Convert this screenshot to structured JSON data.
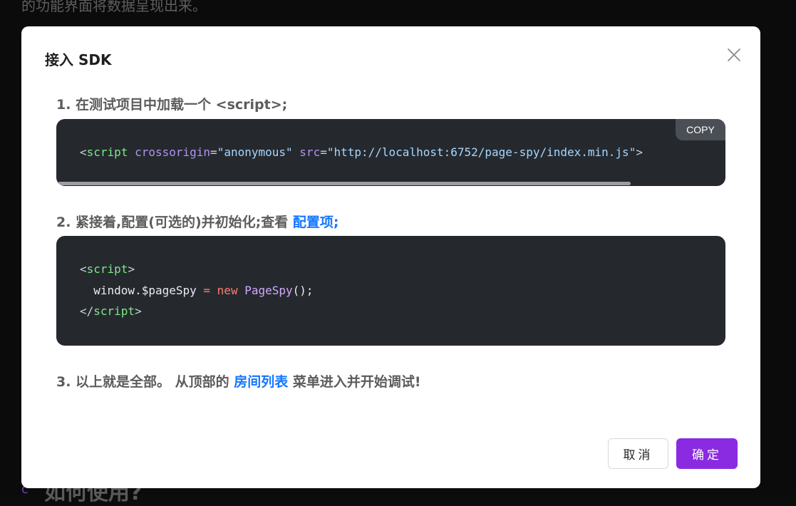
{
  "background": {
    "top_text": "的功能界面将数据呈现出来。",
    "heading": "如何使用?",
    "bullet": "c"
  },
  "modal": {
    "title": "接入 SDK",
    "step1": {
      "text": "1. 在测试项目中加载一个 <script>;"
    },
    "code1": {
      "lt": "<",
      "tag": "script",
      "attr1": "crossorigin",
      "eq": "=",
      "val1": "\"anonymous\"",
      "attr2": "src",
      "val2": "\"http://localhost:6752/page-spy/index.min.js\"",
      "gt": ">",
      "copy_label": "COPY"
    },
    "step2": {
      "text": "2. 紧接着,配置(可选的)并初始化;查看 ",
      "link": "配置项;"
    },
    "code2": {
      "line1_lt": "<",
      "line1_tag": "script",
      "line1_gt": ">",
      "line2_indent": "  ",
      "line2_obj": "window.$pageSpy",
      "line2_op": " = ",
      "line2_kw": "new",
      "line2_cls": "PageSpy",
      "line2_end": "();",
      "line3_lt": "</",
      "line3_tag": "script",
      "line3_gt": ">"
    },
    "step3": {
      "text": "3. 以上就是全部。 从顶部的 ",
      "link": "房间列表",
      "rest": " 菜单进入并开始调试!"
    },
    "buttons": {
      "cancel": "取消",
      "ok": "确定"
    }
  },
  "colors": {
    "primary": "#8a2be2",
    "link": "#1677ff",
    "code_bg": "#25292e"
  }
}
